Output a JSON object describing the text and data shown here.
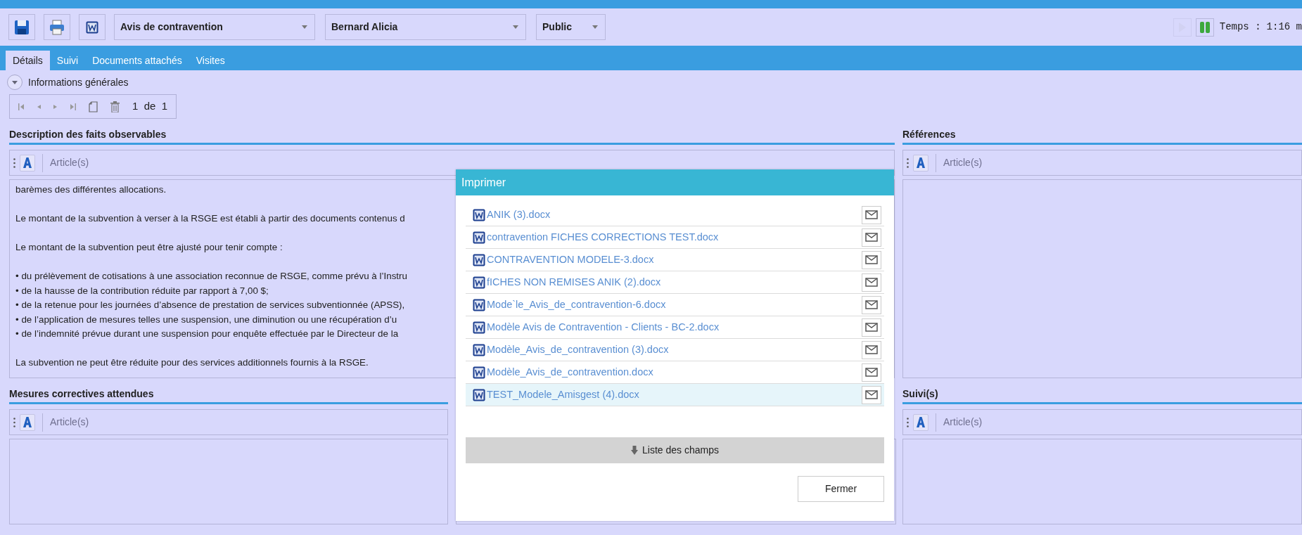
{
  "toolbar": {
    "dropdowns": [
      {
        "value": "Avis de contravention"
      },
      {
        "value": "Bernard Alicia"
      },
      {
        "value": "Public"
      }
    ],
    "timer": {
      "play_disabled": true,
      "label": "Temps :",
      "value": "1:16 m"
    }
  },
  "tabs": [
    {
      "label": "Détails",
      "selected": true
    },
    {
      "label": "Suivi",
      "selected": false
    },
    {
      "label": "Documents attachés",
      "selected": false
    },
    {
      "label": "Visites",
      "selected": false
    }
  ],
  "group": {
    "label": "Informations générales",
    "expanded": true
  },
  "pager": {
    "current": "1",
    "of": "de",
    "total": "1"
  },
  "sections": [
    {
      "title": "Description des faits observables",
      "toolbar_label": "Article(s)",
      "paragraphs": [
        {
          "lines": [
            "barèmes des différentes allocations."
          ]
        },
        {
          "lines": [
            "Le montant de la subvention à verser à la RSGE est établi à partir des documents contenus d"
          ]
        },
        {
          "lines": [
            "Le montant de la subvention peut être ajusté pour tenir compte :"
          ]
        },
        {
          "lines": [
            "• du prélèvement de cotisations à une association reconnue de RSGE, comme prévu à l’Instru",
            "• de la hausse de la contribution réduite par rapport à 7,00 $;",
            "• de la retenue pour les journées d’absence de prestation de services subventionnée (APSS),",
            "• de l’application de mesures telles une suspension, une diminution ou une récupération d’u",
            "• de l’indemnité prévue durant une suspension pour enquête effectuée par le Directeur de la"
          ]
        },
        {
          "lines": [
            "La subvention ne peut être réduite pour des services additionnels fournis à la RSGE."
          ]
        }
      ]
    },
    {
      "title": "Références",
      "toolbar_label": "Article(s)"
    },
    {
      "title": "Mesures correctives attendues",
      "toolbar_label": "Article(s)"
    },
    {
      "title": "Suivi(s)",
      "toolbar_label": "Article(s)"
    }
  ],
  "dialog": {
    "title": "Imprimer",
    "files": [
      {
        "name": "ANIK (3).docx",
        "selected": false
      },
      {
        "name": "contravention FICHES CORRECTIONS TEST.docx",
        "selected": false
      },
      {
        "name": "CONTRAVENTION MODELE-3.docx",
        "selected": false
      },
      {
        "name": "fICHES NON REMISES ANIK (2).docx",
        "selected": false
      },
      {
        "name": "Mode`le_Avis_de_contravention-6.docx",
        "selected": false
      },
      {
        "name": "Modèle Avis de Contravention - Clients - BC-2.docx",
        "selected": false
      },
      {
        "name": "Modèle_Avis_de_contravention (3).docx",
        "selected": false
      },
      {
        "name": "Modèle_Avis_de_contravention.docx",
        "selected": false
      },
      {
        "name": "TEST_Modele_Amisgest (4).docx",
        "selected": true
      }
    ],
    "fields_button": "Liste des champs",
    "close_button": "Fermer"
  }
}
